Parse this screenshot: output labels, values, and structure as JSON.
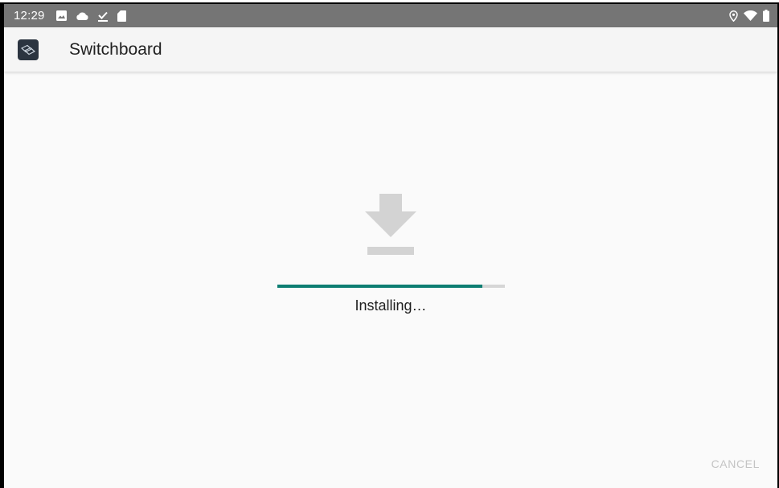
{
  "status_bar": {
    "time": "12:29",
    "left_icons": [
      "image-icon",
      "cloud-icon",
      "download-done-icon",
      "sd-card-icon"
    ],
    "right_icons": [
      "location-icon",
      "wifi-icon",
      "battery-icon"
    ],
    "background_color": "#757575"
  },
  "app_bar": {
    "app_icon": "switchboard-app-icon",
    "title": "Switchboard"
  },
  "install": {
    "icon": "download-icon",
    "progress_percent": 90,
    "status": "Installing…",
    "accent_color": "#0e7e72"
  },
  "actions": {
    "cancel_label": "CANCEL"
  }
}
